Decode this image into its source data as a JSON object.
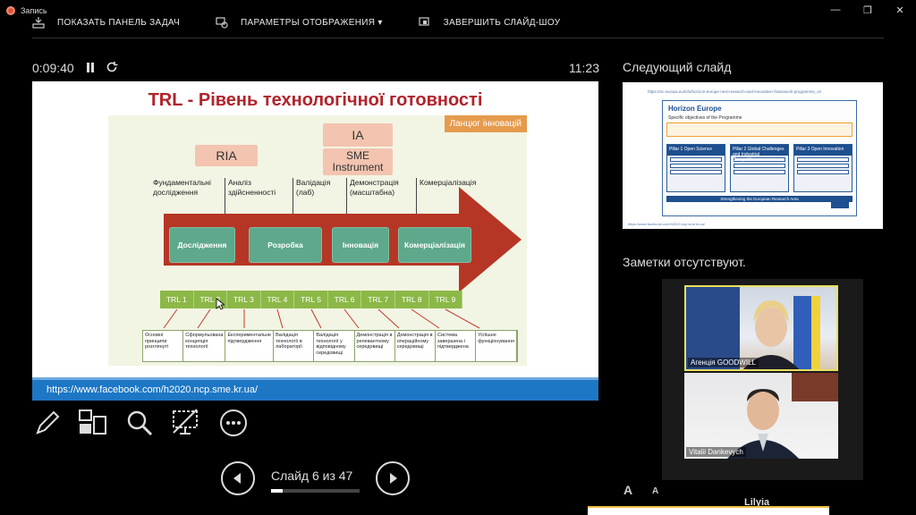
{
  "window": {
    "record_label": "Запись",
    "controls": [
      "—",
      "❐",
      "✕"
    ]
  },
  "toolbar": {
    "show_taskbar": "ПОКАЗАТЬ ПАНЕЛЬ ЗАДАЧ",
    "display_settings": "ПАРАМЕТРЫ ОТОБРАЖЕНИЯ ▾",
    "end_show": "ЗАВЕРШИТЬ СЛАЙД-ШОУ"
  },
  "timer": {
    "elapsed": "0:09:40",
    "clock": "11:23"
  },
  "slide": {
    "title": "TRL - Рівень технологічної готовності",
    "chain_tag": "Ланцюг інновацій",
    "tags": {
      "ria": "RIA",
      "ia": "IA",
      "sme": "SME Instrument"
    },
    "stages": [
      "Фундаментальні дослідження",
      "Аналіз здійсненності",
      "Валідація (лаб)",
      "Демонстрація (масштабна)",
      "Комерціалізація"
    ],
    "phases": [
      "Дослідження",
      "Розробка",
      "Інновація",
      "Комерціалізація"
    ],
    "trl": [
      "TRL 1",
      "TRL 2",
      "TRL 3",
      "TRL 4",
      "TRL 5",
      "TRL 6",
      "TRL 7",
      "TRL 8",
      "TRL 9"
    ],
    "descriptions": [
      "Основні принципи розглянуті",
      "Сформульована концепція технології",
      "Експериментальне підтвердження",
      "Валідація технології в лабораторії",
      "Валідація технології у відповідному середовищі",
      "Демонстрація в релевантному середовищі",
      "Демонстрація в операційному середовищі",
      "Система завершена і підтверджена",
      "Успішне функціонування"
    ],
    "footer_url": "https://www.facebook.com/h2020.ncp.sme.kr.ua/"
  },
  "navigation": {
    "counter": "Слайд 6 из 47",
    "progress": 0.128
  },
  "next_slide": {
    "label": "Следующий слайд",
    "url": "https://ec.europa.eu/info/horizon-europe-next-research-and-innovation-framework-programme_en",
    "title": "Horizon Europe",
    "subtitle": "Specific objectives of the Programme",
    "pillars": [
      "Pillar 1 Open Science",
      "Pillar 2 Global Challenges and Industrial Competitiveness",
      "Pillar 3 Open Innovation"
    ],
    "bottom_bar": "Strengthening the European Research Area",
    "footer_url": "https://www.facebook.com/h2020.ncp.sme.kr.ua/"
  },
  "notes": {
    "text": "Заметки отсутствуют."
  },
  "participants": [
    {
      "name": "Агенція GOODWILL"
    },
    {
      "name": "Vitalii Dankevych"
    }
  ],
  "bottom": {
    "font_big": "A",
    "font_small": "A",
    "name": "Lilyia"
  }
}
